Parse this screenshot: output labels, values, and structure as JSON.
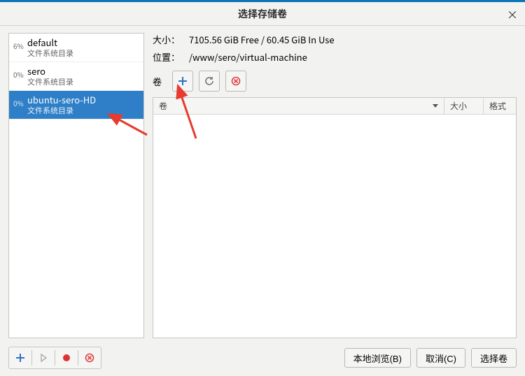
{
  "window": {
    "title": "选择存储卷",
    "close": "×"
  },
  "pools": [
    {
      "pct": "6%",
      "name": "default",
      "type": "文件系统目录",
      "selected": false
    },
    {
      "pct": "0%",
      "name": "sero",
      "type": "文件系统目录",
      "selected": false
    },
    {
      "pct": "0%",
      "name": "ubuntu-sero-HD",
      "type": "文件系统目录",
      "selected": true
    }
  ],
  "details": {
    "size_label": "大小：",
    "size_value": "7105.56 GiB Free / 60.45 GiB In Use",
    "location_label": "位置：",
    "location_value": "/www/sero/virtual-machine",
    "vol_label": "卷"
  },
  "vol_header": {
    "name": "卷",
    "size": "大小",
    "format": "格式"
  },
  "footer": {
    "browse": "本地浏览(B)",
    "cancel": "取消(C)",
    "choose": "选择卷"
  },
  "icons": {
    "add": "plus-icon",
    "refresh": "refresh-icon",
    "delete": "delete-icon",
    "play": "play-icon",
    "stop": "stop-icon"
  }
}
